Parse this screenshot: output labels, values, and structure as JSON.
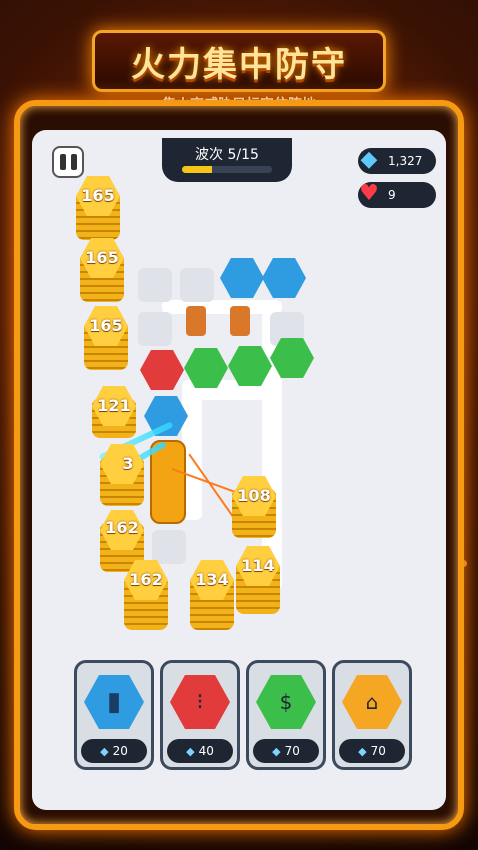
{
  "header": {
    "title": "火力集中防守",
    "subtitle": "集火高威胁目标守住阵地"
  },
  "hud": {
    "wave_label": "波次 5/15",
    "wave_progress": 0.33,
    "gems": "1,327",
    "lives": "9"
  },
  "enemy_stacks": [
    "165",
    "165",
    "165",
    "121",
    "3",
    "162",
    "162",
    "134",
    "114",
    "108"
  ],
  "towers": [
    {
      "name": "cannon",
      "cost": "20",
      "color": "#2f9be0"
    },
    {
      "name": "signal",
      "cost": "40",
      "color": "#e23b3b"
    },
    {
      "name": "money",
      "cost": "70",
      "color": "#3cbf4a"
    },
    {
      "name": "sprayer",
      "cost": "70",
      "color": "#f5a623"
    }
  ],
  "colors": {
    "accent": "#f59a12",
    "gold": "#f2b31a"
  }
}
